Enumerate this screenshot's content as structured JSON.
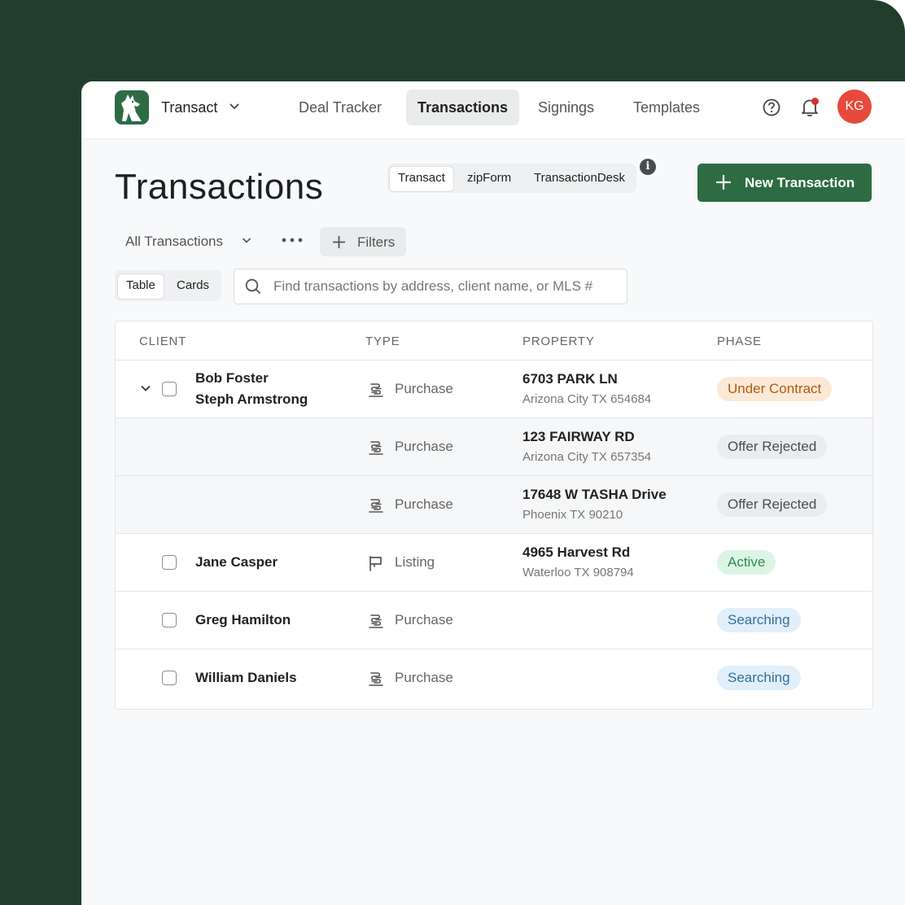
{
  "header": {
    "brand": "Transact",
    "nav": [
      "Deal Tracker",
      "Transactions",
      "Signings",
      "Templates"
    ],
    "active_nav": "Transactions",
    "avatar_initials": "KG"
  },
  "page": {
    "title": "Transactions",
    "source_options": [
      "Transact",
      "zipForm",
      "TransactionDesk"
    ],
    "active_source": "Transact",
    "new_button": "New Transaction",
    "view_select": "All Transactions",
    "filters_label": "Filters",
    "layout_options": [
      "Table",
      "Cards"
    ],
    "active_layout": "Table",
    "search_placeholder": "Find transactions by address, client name, or MLS #"
  },
  "table": {
    "columns": [
      "CLIENT",
      "TYPE",
      "PROPERTY",
      "PHASE"
    ],
    "rows": [
      {
        "clients": [
          "Bob Foster",
          "Steph Armstrong"
        ],
        "type": "Purchase",
        "address": "6703 PARK LN",
        "city": "Arizona City TX 654684",
        "phase": "Under Contract"
      },
      {
        "clients": [],
        "type": "Purchase",
        "address": "123 FAIRWAY RD",
        "city": "Arizona City TX 657354",
        "phase": "Offer Rejected"
      },
      {
        "clients": [],
        "type": "Purchase",
        "address": "17648 W TASHA Drive",
        "city": "Phoenix TX 90210",
        "phase": "Offer Rejected"
      },
      {
        "clients": [
          "Jane Casper"
        ],
        "type": "Listing",
        "address": "4965 Harvest Rd",
        "city": "Waterloo TX 908794",
        "phase": "Active"
      },
      {
        "clients": [
          "Greg Hamilton"
        ],
        "type": "Purchase",
        "address": "",
        "city": "",
        "phase": "Searching"
      },
      {
        "clients": [
          "William Daniels"
        ],
        "type": "Purchase",
        "address": "",
        "city": "",
        "phase": "Searching"
      }
    ]
  },
  "colors": {
    "frame_bg": "#233d2d",
    "primary": "#2e6b43",
    "avatar": "#e8493d",
    "under_contract_bg": "#fbe9d6",
    "under_contract_text": "#b05a12",
    "offer_rejected_bg": "#ebecee",
    "offer_rejected_text": "#4a4d50",
    "active_bg": "#dcf4e4",
    "active_text": "#2f8a4f",
    "searching_bg": "#e1effa",
    "searching_text": "#2f6f9f"
  },
  "icons": {
    "logo": "wolf-logo",
    "help": "help-circle-icon",
    "notifications": "bell-icon",
    "search": "search-icon",
    "purchase": "purchase-icon",
    "listing": "listing-flag-icon"
  }
}
